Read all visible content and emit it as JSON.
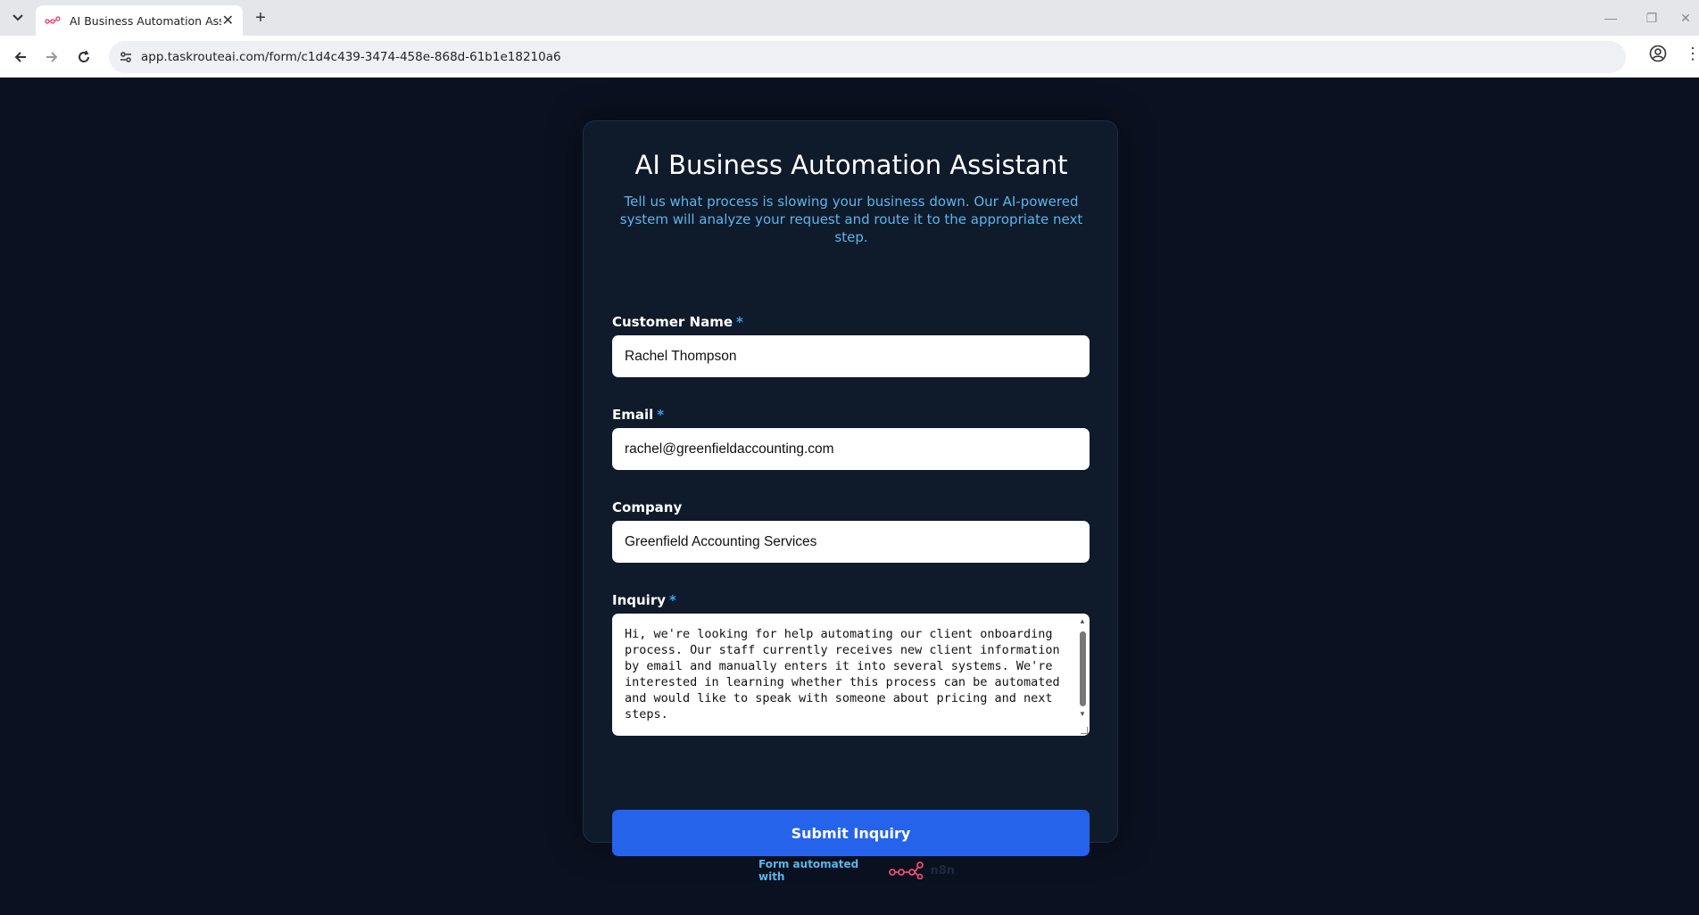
{
  "browser": {
    "tab_title": "AI Business Automation Assista",
    "tab_close": "✕",
    "new_tab": "+",
    "url": "app.taskrouteai.com/form/c1d4c439-3474-458e-868d-61b1e18210a6",
    "window_controls": {
      "minimize": "—",
      "restore": "❐",
      "close": "✕"
    }
  },
  "form": {
    "title": "AI Business Automation Assistant",
    "subtitle": "Tell us what process is slowing your business down. Our AI-powered system will analyze your request and route it to the appropriate next step.",
    "fields": {
      "customer_name": {
        "label": "Customer Name",
        "required_mark": "*",
        "value": "Rachel Thompson"
      },
      "email": {
        "label": "Email",
        "required_mark": "*",
        "value": "rachel@greenfieldaccounting.com"
      },
      "company": {
        "label": "Company",
        "value": "Greenfield Accounting Services"
      },
      "inquiry": {
        "label": "Inquiry",
        "required_mark": "*",
        "value": "Hi, we're looking for help automating our client onboarding process. Our staff currently receives new client information by email and manually enters it into several systems. We're interested in learning whether this process can be automated and would like to speak with someone about pricing and next steps."
      }
    },
    "submit_label": "Submit Inquiry"
  },
  "footer": {
    "text": "Form automated with",
    "brand": "n8n"
  },
  "colors": {
    "page_bg": "#0a1120",
    "card_bg": "#0f1a2b",
    "accent": "#5ab6ec",
    "button": "#2563eb",
    "logo": "#ea4b71"
  }
}
